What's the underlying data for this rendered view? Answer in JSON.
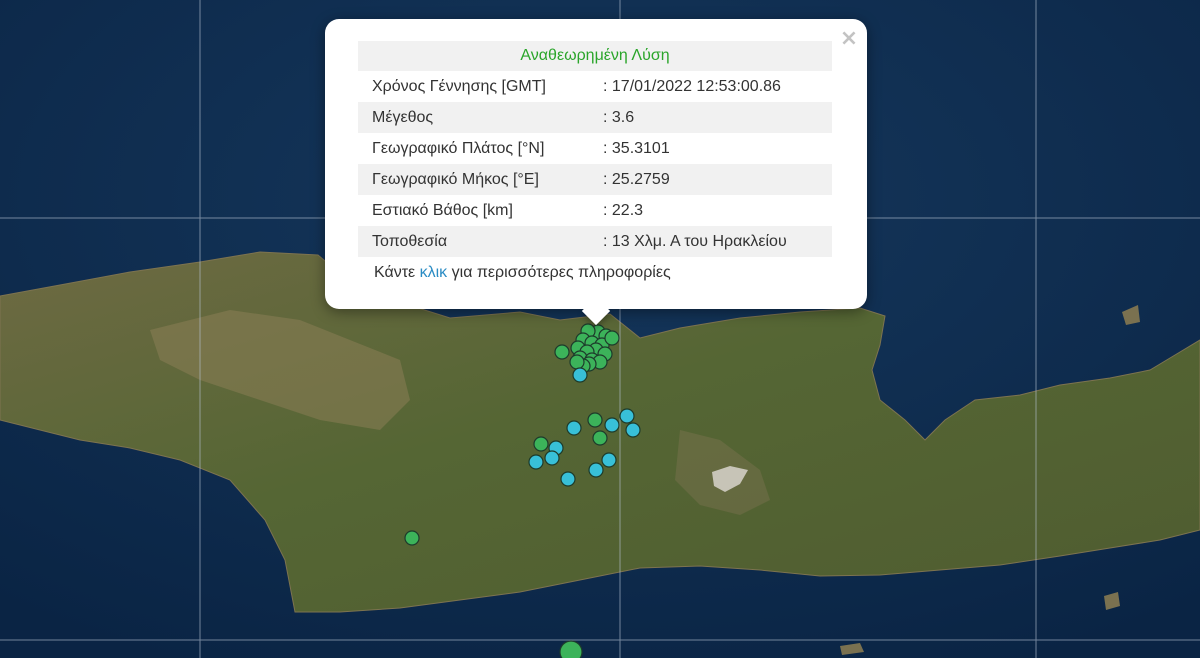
{
  "popup": {
    "title": "Αναθεωρημένη Λύση",
    "close_glyph": "×",
    "rows": [
      {
        "label": "Χρόνος Γέννησης [GMT]",
        "value": ": 17/01/2022 12:53:00.86"
      },
      {
        "label": "Μέγεθος",
        "value": ": 3.6"
      },
      {
        "label": "Γεωγραφικό Πλάτος [°N]",
        "value": ": 35.3101"
      },
      {
        "label": "Γεωγραφικό Μήκος [°E]",
        "value": ": 25.2759"
      },
      {
        "label": "Εστιακό Βάθος [km]",
        "value": ": 22.3"
      },
      {
        "label": "Τοποθεσία",
        "value": ": 13 Χλμ. Α του Ηρακλείου"
      }
    ],
    "footer": {
      "before": "Κάντε ",
      "link": "κλικ",
      "after": " για περισσότερες πληροφορίες"
    }
  },
  "colors": {
    "sea": "#0d2b4e",
    "land": "#5f6a38",
    "marker_green": "#3cb35a",
    "marker_cyan": "#38c0d8",
    "title_green": "#2aa52a",
    "link_blue": "#2b8cc4"
  }
}
